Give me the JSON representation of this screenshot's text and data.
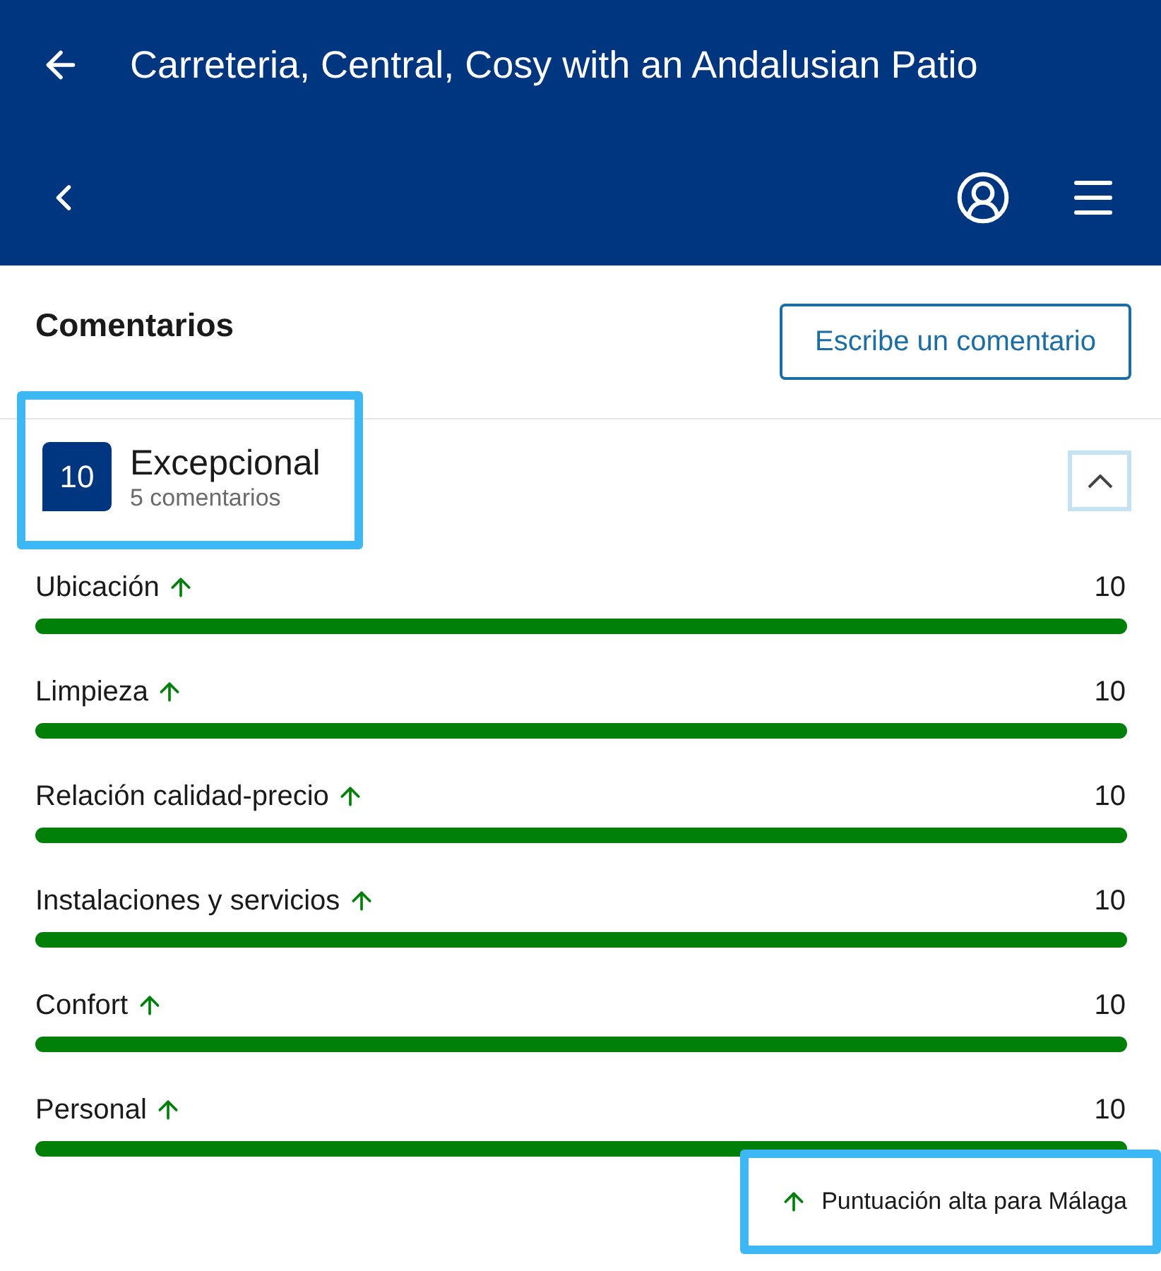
{
  "header": {
    "title": "Carreteria, Central, Cosy with an Andalusian Patio"
  },
  "section": {
    "title": "Comentarios",
    "action": "Escribe un comentario"
  },
  "summary": {
    "score": "10",
    "rating": "Excepcional",
    "count": "5 comentarios",
    "highlighted": true,
    "expanded": true
  },
  "categories": [
    {
      "label": "Ubicación",
      "score": "10",
      "level": 1,
      "high": true
    },
    {
      "label": "Limpieza",
      "score": "10",
      "level": 1,
      "high": true
    },
    {
      "label": "Relación calidad-precio",
      "score": "10",
      "level": 1,
      "high": true
    },
    {
      "label": "Instalaciones y servicios",
      "score": "10",
      "level": 1,
      "high": true
    },
    {
      "label": "Confort",
      "score": "10",
      "level": 1,
      "high": true
    },
    {
      "label": "Personal",
      "score": "10",
      "level": 1,
      "high": true
    }
  ],
  "legend": {
    "text": "Puntuación alta para Málaga",
    "highlighted": true
  }
}
